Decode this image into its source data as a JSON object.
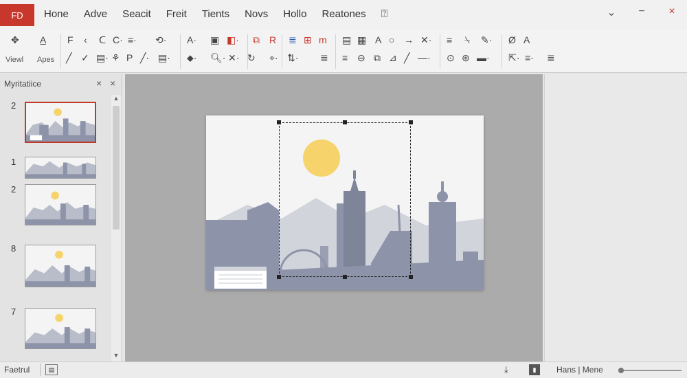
{
  "titlebar": {
    "file_label": "FD",
    "menu": [
      "Hone",
      "Adve",
      "Seacit",
      "Freit",
      "Tients",
      "Novs",
      "Hollo",
      "Reatones"
    ],
    "help_icon": "help-icon",
    "controls": {
      "minimize": "⌄",
      "restore": "−",
      "close": "×"
    }
  },
  "ribbon": {
    "row1": [
      {
        "g": "✥",
        "n": "move-icon"
      },
      {
        "g": "A̲",
        "n": "font-icon"
      },
      {
        "g": "F",
        "n": "bold-icon"
      },
      {
        "g": "‹",
        "n": "chevron-left-icon"
      },
      {
        "g": "ᑕ",
        "n": "bracket-icon"
      },
      {
        "g": "C·",
        "n": "cycle-icon"
      },
      {
        "g": "≡·",
        "n": "align-icon"
      },
      {
        "g": "⟲·",
        "n": "rotate-icon"
      },
      {
        "g": "A·",
        "n": "text-color-icon"
      },
      {
        "g": "▣",
        "n": "box-icon"
      },
      {
        "g": "◧·",
        "n": "shape-fill-icon"
      },
      {
        "g": "⧉",
        "n": "copy-icon"
      },
      {
        "g": "R",
        "n": "r-icon"
      },
      {
        "g": "≣",
        "n": "list-icon"
      },
      {
        "g": "⊞",
        "n": "grid-icon"
      },
      {
        "g": "m",
        "n": "m-icon"
      },
      {
        "g": "▤",
        "n": "table-icon"
      },
      {
        "g": "▦",
        "n": "matrix-icon"
      },
      {
        "g": "A",
        "n": "text-icon"
      },
      {
        "g": "○",
        "n": "circle-icon"
      },
      {
        "g": "→",
        "n": "arrow-icon"
      },
      {
        "g": "✕·",
        "n": "cross-icon"
      },
      {
        "g": "≡",
        "n": "menu-icon"
      },
      {
        "g": "⍀",
        "n": "slash-icon"
      },
      {
        "g": "✎·",
        "n": "pen-icon"
      },
      {
        "g": "Ø",
        "n": "zero-icon"
      },
      {
        "g": "A",
        "n": "letter-a-icon"
      }
    ],
    "row2_labels": {
      "view": "Viewl",
      "apes": "Apes"
    },
    "row2": [
      {
        "g": "╱",
        "n": "line-icon"
      },
      {
        "g": "✓",
        "n": "check-icon"
      },
      {
        "g": "▤·",
        "n": "doc-icon"
      },
      {
        "g": "⚘",
        "n": "format-painter-icon"
      },
      {
        "g": "P",
        "n": "p-icon"
      },
      {
        "g": "╱·",
        "n": "draw-icon"
      },
      {
        "g": "▤·",
        "n": "page-icon"
      },
      {
        "g": "⬥·",
        "n": "fill-icon"
      },
      {
        "g": "🔍︎·",
        "n": "search-icon"
      },
      {
        "g": "✕·",
        "n": "clear-icon"
      },
      {
        "g": "↻",
        "n": "refresh-icon"
      },
      {
        "g": "⌖·",
        "n": "target-icon"
      },
      {
        "g": "⇅·",
        "n": "sort-icon"
      },
      {
        "g": "≣",
        "n": "paragraph-icon"
      },
      {
        "g": "≡",
        "n": "lines-icon"
      },
      {
        "g": "⊖",
        "n": "minus-circle-icon"
      },
      {
        "g": "⧉",
        "n": "duplicate-icon"
      },
      {
        "g": "⊿",
        "n": "triangle-icon"
      },
      {
        "g": "╱",
        "n": "diagonal-icon"
      },
      {
        "g": "—·",
        "n": "dash-icon"
      },
      {
        "g": "⊙",
        "n": "dot-circle-icon"
      },
      {
        "g": "⊛",
        "n": "star-circle-icon"
      },
      {
        "g": "▬·",
        "n": "bar-icon"
      },
      {
        "g": "⇱·",
        "n": "corner-icon"
      },
      {
        "g": "≡·",
        "n": "more-icon"
      },
      {
        "g": "≣",
        "n": "options-icon"
      }
    ]
  },
  "slides_pane": {
    "title": "Myritatiice",
    "close_icon": "×",
    "slides": [
      {
        "number": "2",
        "selected": true
      },
      {
        "number": "1",
        "selected": false
      },
      {
        "number": "2",
        "selected": false
      },
      {
        "number": "8",
        "selected": false
      },
      {
        "number": "7",
        "selected": false
      }
    ]
  },
  "status": {
    "left": "Faetrul",
    "notes": "Hans | Mene",
    "zoom_level": 0.0
  },
  "colors": {
    "accent": "#c7372c",
    "sun": "#f6d36b",
    "building": "#8d93a8",
    "building_light": "#b9bdc9"
  }
}
